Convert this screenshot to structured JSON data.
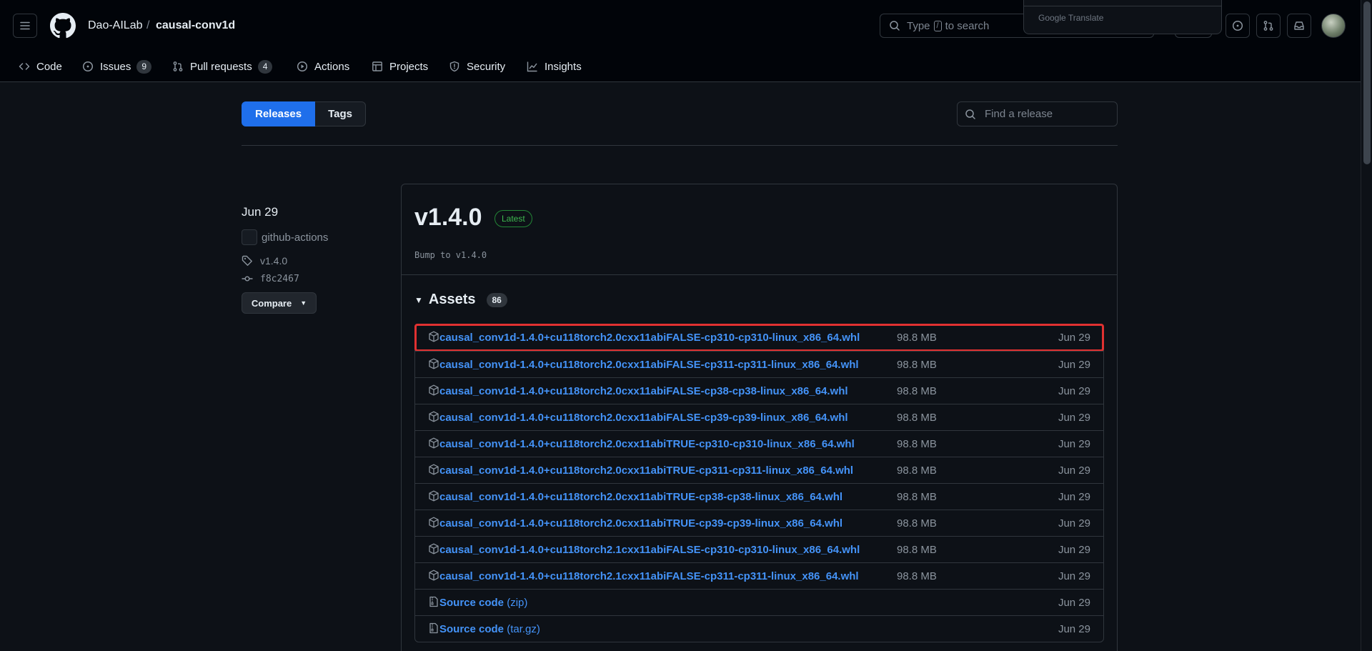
{
  "header": {
    "owner": "Dao-AILab",
    "separator": "/",
    "repo": "causal-conv1d",
    "search_prefix": "Type",
    "search_key": "/",
    "search_suffix": "to search",
    "translate_popup": "Google Translate"
  },
  "repo_nav": {
    "code": "Code",
    "issues": "Issues",
    "issues_count": "9",
    "pulls": "Pull requests",
    "pulls_count": "4",
    "actions": "Actions",
    "projects": "Projects",
    "security": "Security",
    "insights": "Insights"
  },
  "subnav": {
    "releases": "Releases",
    "tags": "Tags",
    "find_placeholder": "Find a release"
  },
  "release": {
    "date": "Jun 29",
    "author": "github-actions",
    "tag": "v1.4.0",
    "commit": "f8c2467",
    "compare": "Compare",
    "version": "v1.4.0",
    "latest_badge": "Latest",
    "notes": "Bump to v1.4.0",
    "assets_title": "Assets",
    "assets_count": "86"
  },
  "assets": [
    {
      "name": "causal_conv1d-1.4.0+cu118torch2.0cxx11abiFALSE-cp310-cp310-linux_x86_64.whl",
      "size": "98.8 MB",
      "date": "Jun 29"
    },
    {
      "name": "causal_conv1d-1.4.0+cu118torch2.0cxx11abiFALSE-cp311-cp311-linux_x86_64.whl",
      "size": "98.8 MB",
      "date": "Jun 29"
    },
    {
      "name": "causal_conv1d-1.4.0+cu118torch2.0cxx11abiFALSE-cp38-cp38-linux_x86_64.whl",
      "size": "98.8 MB",
      "date": "Jun 29"
    },
    {
      "name": "causal_conv1d-1.4.0+cu118torch2.0cxx11abiFALSE-cp39-cp39-linux_x86_64.whl",
      "size": "98.8 MB",
      "date": "Jun 29"
    },
    {
      "name": "causal_conv1d-1.4.0+cu118torch2.0cxx11abiTRUE-cp310-cp310-linux_x86_64.whl",
      "size": "98.8 MB",
      "date": "Jun 29"
    },
    {
      "name": "causal_conv1d-1.4.0+cu118torch2.0cxx11abiTRUE-cp311-cp311-linux_x86_64.whl",
      "size": "98.8 MB",
      "date": "Jun 29"
    },
    {
      "name": "causal_conv1d-1.4.0+cu118torch2.0cxx11abiTRUE-cp38-cp38-linux_x86_64.whl",
      "size": "98.8 MB",
      "date": "Jun 29"
    },
    {
      "name": "causal_conv1d-1.4.0+cu118torch2.0cxx11abiTRUE-cp39-cp39-linux_x86_64.whl",
      "size": "98.8 MB",
      "date": "Jun 29"
    },
    {
      "name": "causal_conv1d-1.4.0+cu118torch2.1cxx11abiFALSE-cp310-cp310-linux_x86_64.whl",
      "size": "98.8 MB",
      "date": "Jun 29"
    },
    {
      "name": "causal_conv1d-1.4.0+cu118torch2.1cxx11abiFALSE-cp311-cp311-linux_x86_64.whl",
      "size": "98.8 MB",
      "date": "Jun 29"
    }
  ],
  "source_code": [
    {
      "label": "Source code",
      "format": "(zip)",
      "date": "Jun 29"
    },
    {
      "label": "Source code",
      "format": "(tar.gz)",
      "date": "Jun 29"
    }
  ],
  "colors": {
    "accent": "#1f6feb",
    "link": "#4493f8",
    "highlight": "#e03131",
    "latest": "#3fb950"
  },
  "icons": {
    "menu": "hamburger-icon",
    "logo": "github-mark-icon",
    "search": "search-icon",
    "package": "package-icon",
    "zip": "file-zip-icon",
    "tag": "tag-icon",
    "commit": "git-commit-icon"
  }
}
